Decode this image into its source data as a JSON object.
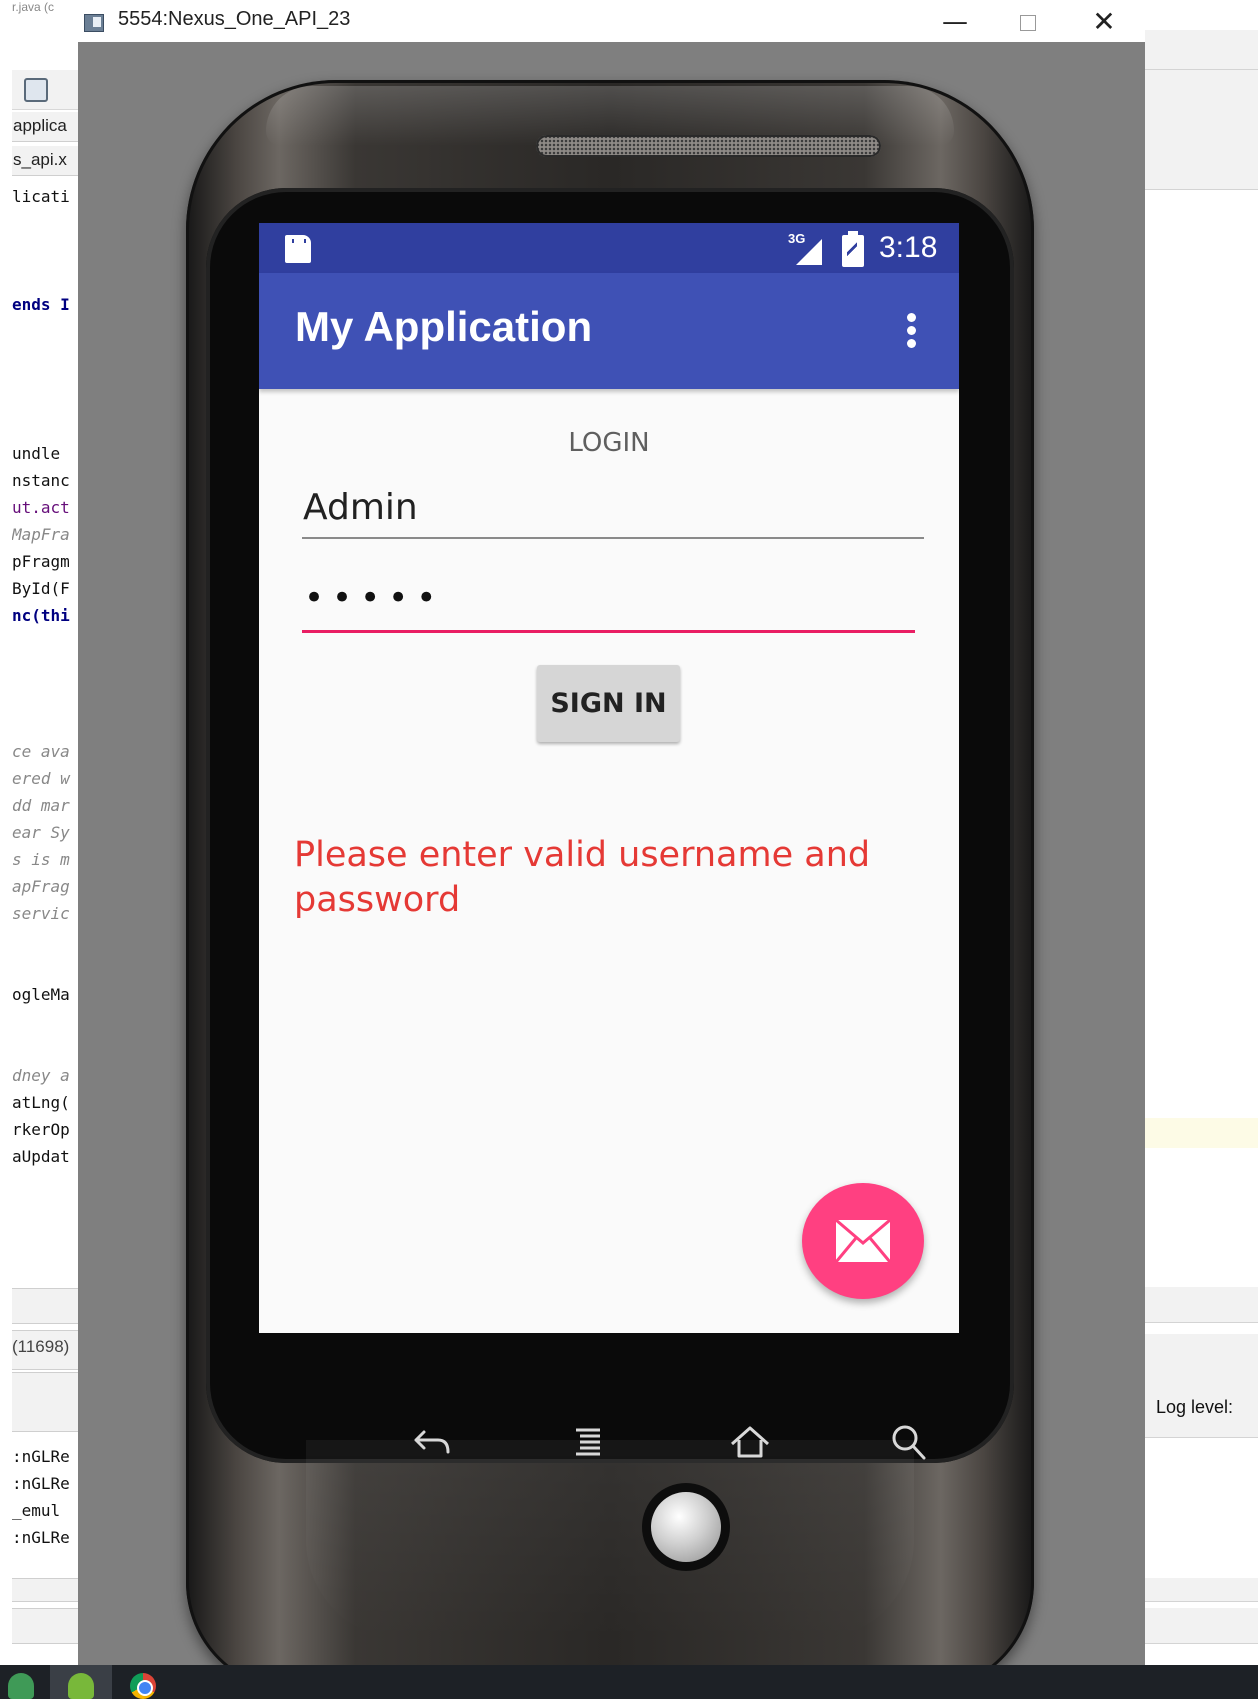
{
  "ide": {
    "title_fragment": "r.java (c",
    "tabs": [
      "applica",
      "s_api.x"
    ],
    "code_top": [
      "licati",
      "",
      "",
      "",
      "ends I"
    ],
    "code_mid": [
      "undle",
      "nstanc",
      "ut.act",
      "MapFra",
      "pFragm",
      "ById(F",
      "nc(thi"
    ],
    "comments": [
      "ce ava",
      "ered w",
      "dd mar",
      "ear Sy",
      "s is m",
      "apFrag",
      "servic"
    ],
    "code_low": [
      "ogleMa",
      "",
      "",
      "dney a",
      "atLng(",
      "rkerOp",
      "aUpdat"
    ],
    "process_label": "(11698)",
    "log_lines": [
      ":nGLRe",
      ":nGLRe",
      "_emul",
      ":nGLRe"
    ],
    "log_level_label": "Log level:"
  },
  "emulator": {
    "window_title": "5554:Nexus_One_API_23",
    "minimize_glyph": "—",
    "close_glyph": "✕"
  },
  "device": {
    "keys": [
      "back-icon",
      "menu-icon",
      "home-icon",
      "search-icon"
    ]
  },
  "android": {
    "status_bar": {
      "network": "3G",
      "time": "3:18",
      "color": "#303f9f"
    },
    "app_bar": {
      "title": "My Application",
      "color": "#3f51b5"
    },
    "login": {
      "heading": "LOGIN",
      "username_value": "Admin",
      "password_value": "•••••",
      "sign_in_label": "SIGN IN",
      "error_message": "Please enter valid username and password",
      "error_color": "#e53935",
      "accent_color": "#e91e63"
    },
    "fab": {
      "icon": "mail-icon",
      "color": "#ff4081"
    }
  }
}
